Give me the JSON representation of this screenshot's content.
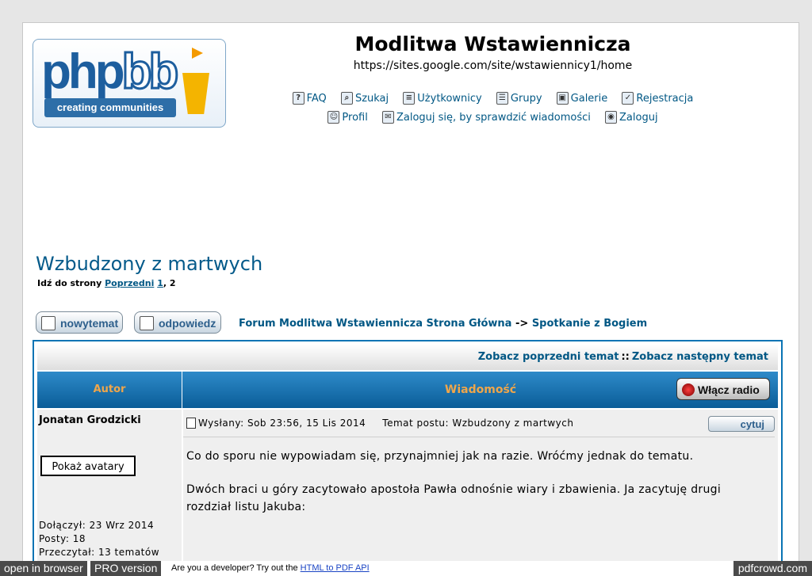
{
  "header": {
    "site_title": "Modlitwa Wstawiennicza",
    "site_url": "https://sites.google.com/site/wstawiennicy1/home",
    "logo": {
      "text_php": "php",
      "text_bb": "bb",
      "tagline": "creating communities"
    }
  },
  "nav": {
    "row1": [
      {
        "label": "FAQ",
        "icon": "question-icon"
      },
      {
        "label": "Szukaj",
        "icon": "search-icon"
      },
      {
        "label": "Użytkownicy",
        "icon": "members-icon"
      },
      {
        "label": "Grupy",
        "icon": "groups-icon"
      },
      {
        "label": "Galerie",
        "icon": "gallery-icon"
      },
      {
        "label": "Rejestracja",
        "icon": "register-icon"
      }
    ],
    "row2": [
      {
        "label": "Profil",
        "icon": "profile-icon"
      },
      {
        "label": "Zaloguj się, by sprawdzić wiadomości",
        "icon": "messages-icon"
      },
      {
        "label": "Zaloguj",
        "icon": "login-icon"
      }
    ]
  },
  "topic": {
    "title": "Wzbudzony z martwych",
    "pages_prefix": "Idź do strony",
    "prev_label": "Poprzedni",
    "page1": "1",
    "page_sep": ", ",
    "page2": "2"
  },
  "buttons": {
    "new_topic": "nowytemat",
    "reply": "odpowiedz"
  },
  "breadcrumb": {
    "home": "Forum Modlitwa Wstawiennicza Strona Główna",
    "sep": "->",
    "forum": "Spotkanie z Bogiem"
  },
  "table": {
    "prev_topic": "Zobacz poprzedni temat",
    "sep": "::",
    "next_topic": "Zobacz następny temat",
    "col_author": "Autor",
    "col_message": "Wiadomość",
    "radio_button": "Włącz radio"
  },
  "post": {
    "author": "Jonatan Grodzicki",
    "avatar_button": "Pokaż avatary",
    "joined": "Dołączył: 23 Wrz 2014",
    "posts": "Posty: 18",
    "created": "Przeczytał: 13 tematów",
    "posted": "Wysłany: Sob 23:56, 15 Lis 2014",
    "subject": "Temat postu: Wzbudzony z martwych",
    "quote_button": "cytuj",
    "body_p1": "Co do sporu nie wypowiadam się, przynajmniej jak na razie. Wróćmy jednak do tematu.",
    "body_p2": "Dwóch braci u góry zacytowało apostoła Pawła odnośnie wiary i zbawienia. Ja zacytuję drugi rozdział listu Jakuba:"
  },
  "footer": {
    "open_in_browser": "open in browser",
    "pro_version": "PRO version",
    "dev_text": "Are you a developer? Try out the",
    "dev_link": "HTML to PDF API",
    "brand": "pdfcrowd.com"
  },
  "colors": {
    "link": "#005784",
    "header_blue": "#0a74b4",
    "header_text": "#f0a64a"
  }
}
